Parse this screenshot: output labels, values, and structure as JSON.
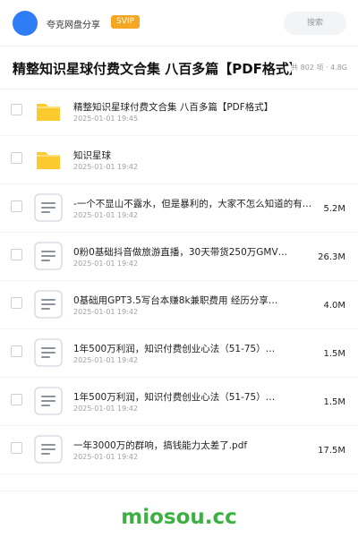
{
  "topbar": {
    "site_name": "夸克网盘分享",
    "badge": "SVIP",
    "search_placeholder": "搜索"
  },
  "header": {
    "title": "精整知识星球付费文合集 八百多篇【PDF格式】",
    "summary": "共 802 项 · 4.8G"
  },
  "files": [
    {
      "type": "folder",
      "name": "精整知识星球付费文合集 八百多篇【PDF格式】",
      "date": "2025-01-01 19:45",
      "size": ""
    },
    {
      "type": "folder",
      "name": "知识星球",
      "date": "2025-01-01 19:42",
      "size": ""
    },
    {
      "type": "doc",
      "name": "-一个不显山不露水，但是暴利的，大家不怎么知道的有…",
      "date": "2025-01-01 19:42",
      "size": "5.2M"
    },
    {
      "type": "doc",
      "name": "0粉0基础抖音做旅游直播，30天带货250万GMV…",
      "date": "2025-01-01 19:42",
      "size": "26.3M"
    },
    {
      "type": "doc",
      "name": "0基础用GPT3.5写台本赚8k兼职费用 经历分享…",
      "date": "2025-01-01 19:42",
      "size": "4.0M"
    },
    {
      "type": "doc",
      "name": "1年500万利润，知识付费创业心法（51-75）…",
      "date": "2025-01-01 19:42",
      "size": "1.5M"
    },
    {
      "type": "doc",
      "name": "1年500万利润，知识付费创业心法（51-75）…",
      "date": "2025-01-01 19:42",
      "size": "1.5M"
    },
    {
      "type": "doc",
      "name": "一年3000万的群响，搞钱能力太差了.pdf",
      "date": "2025-01-01 19:42",
      "size": "17.5M"
    }
  ],
  "footer": {
    "watermark": "miosou.cc"
  },
  "colors": {
    "accent": "#2f7df6",
    "badge": "#f5a623",
    "folder": "#fcc92e",
    "watermark": "#3cb043"
  },
  "icons": {
    "folder": "folder-icon",
    "doc": "document-icon"
  }
}
